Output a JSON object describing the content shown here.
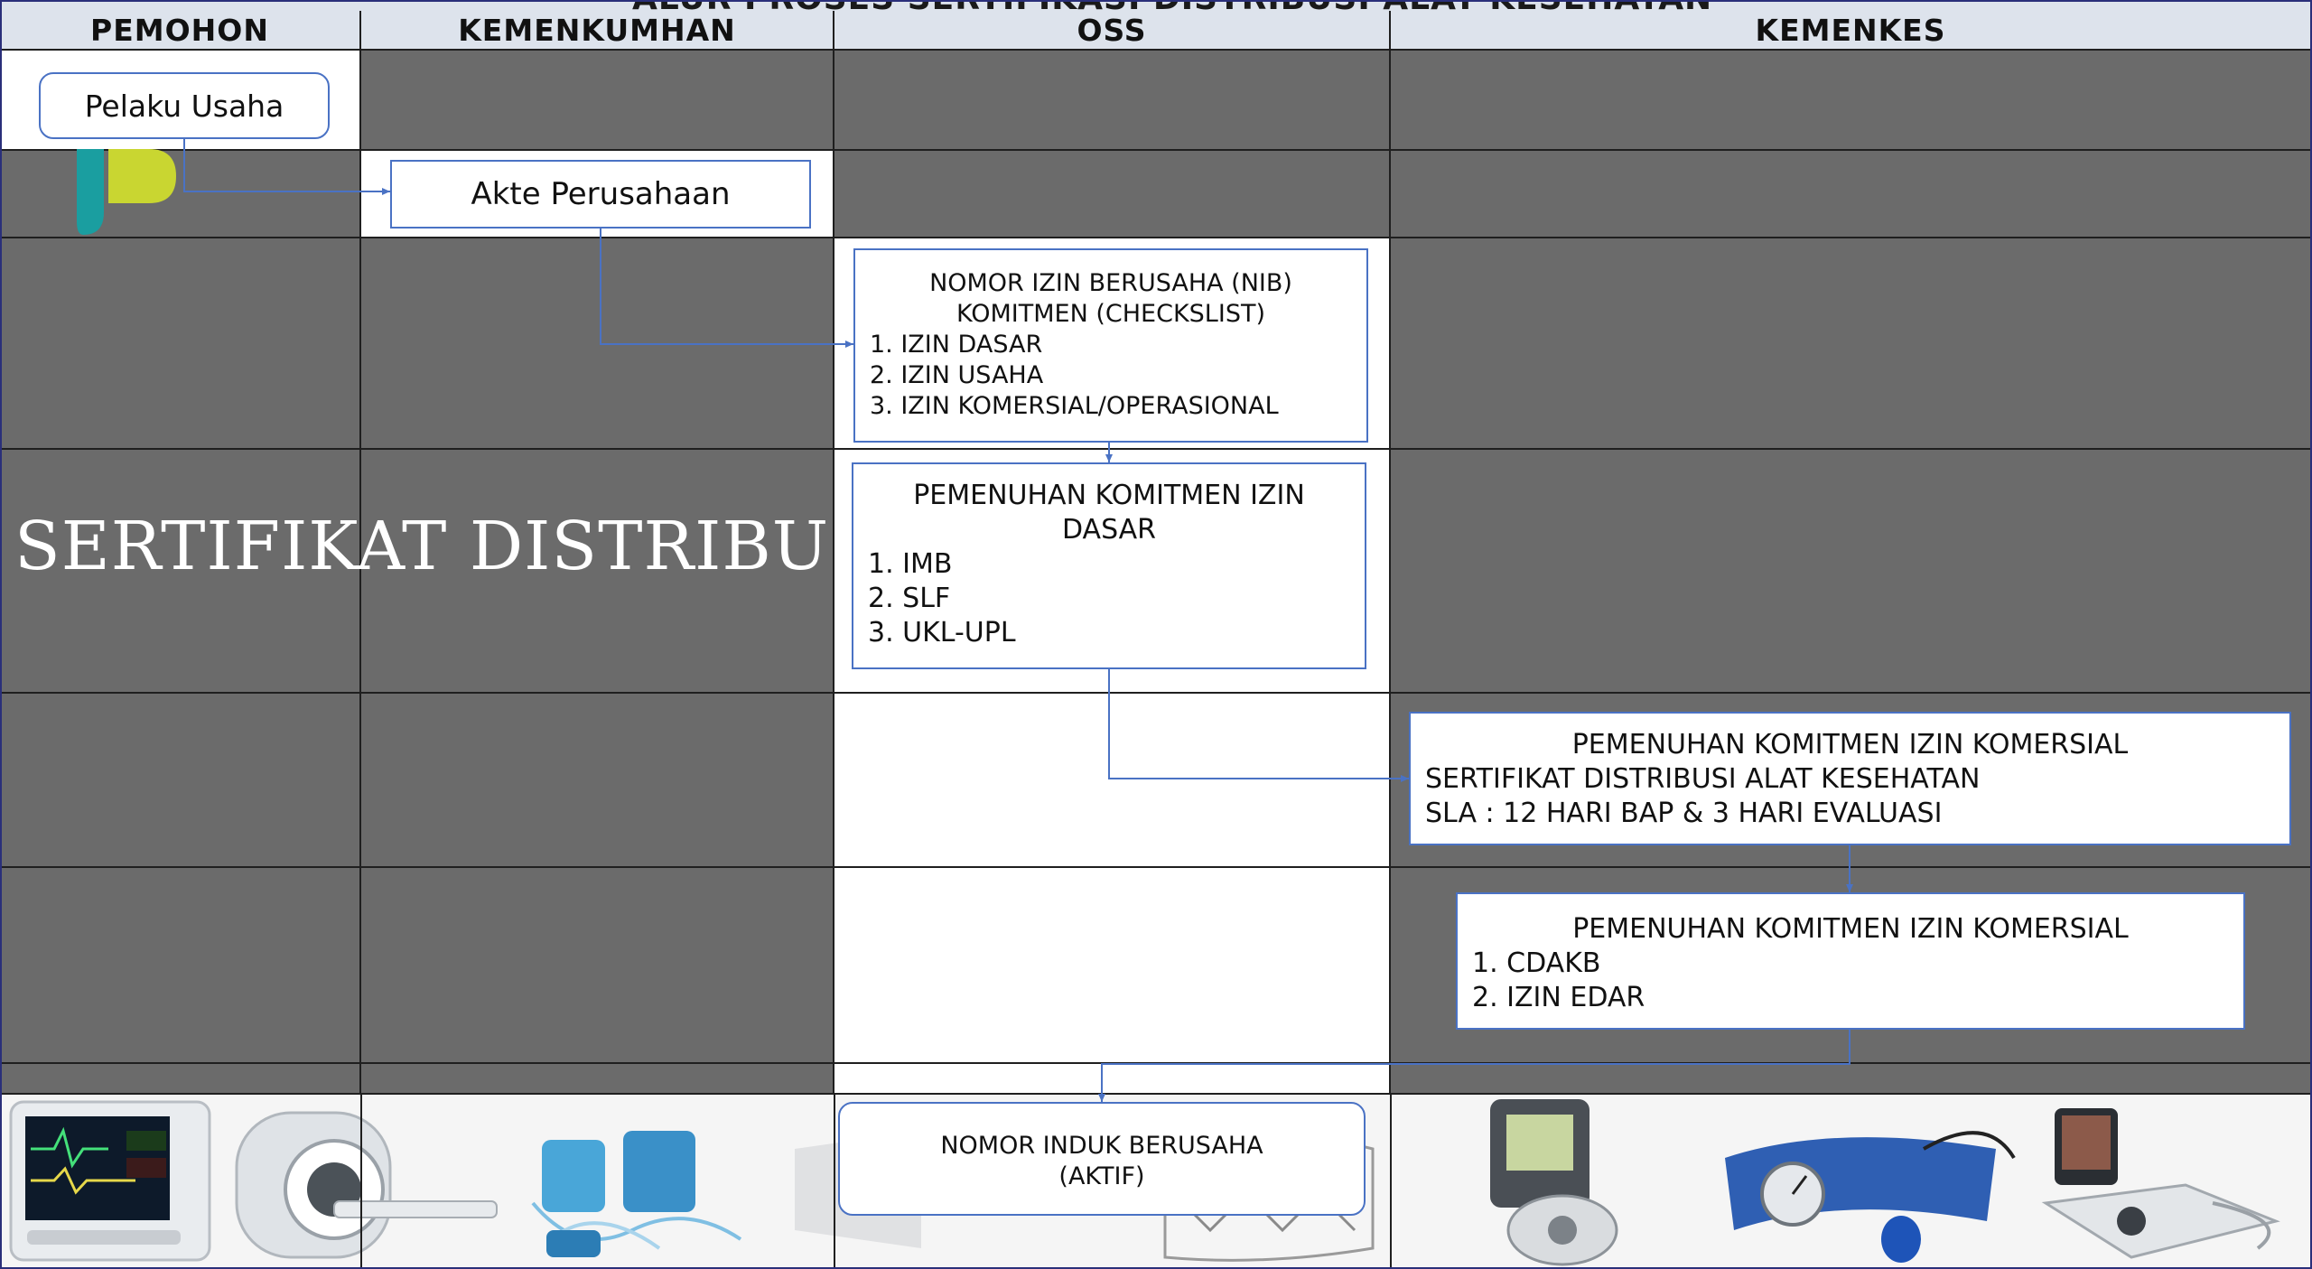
{
  "title": "ALUR PROSES SERTIFIKASI DISTRIBUSI ALAT KESEHATAN",
  "lanes": [
    {
      "label": "PEMOHON"
    },
    {
      "label": "KEMENKUMHAN"
    },
    {
      "label": "OSS"
    },
    {
      "label": "KEMENKES"
    }
  ],
  "side_label": "SERTIFIKAT DISTRIBUSI",
  "steps": {
    "pelaku": "Pelaku Usaha",
    "akte": "Akte Perusahaan",
    "nib": {
      "line1": "NOMOR IZIN BERUSAHA (NIB)",
      "line2": "KOMITMEN (CHECKSLIST)",
      "items": [
        "1. IZIN DASAR",
        "2. IZIN USAHA",
        "3. IZIN KOMERSIAL/OPERASIONAL"
      ]
    },
    "izin_dasar": {
      "title": "PEMENUHAN KOMITMEN IZIN DASAR",
      "items": [
        "1. IMB",
        "2. SLF",
        "3. UKL-UPL"
      ]
    },
    "komersial_1": {
      "title": "PEMENUHAN KOMITMEN IZIN KOMERSIAL",
      "lines": [
        "SERTIFIKAT DISTRIBUSI ALAT KESEHATAN",
        "SLA : 12 HARI BAP & 3 HARI EVALUASI"
      ]
    },
    "komersial_2": {
      "title": "PEMENUHAN KOMITMEN IZIN KOMERSIAL",
      "items": [
        "1. CDAKB",
        "2. IZIN EDAR"
      ]
    },
    "nomor_induk": {
      "line1": "NOMOR INDUK BERUSAHA",
      "line2": "(AKTIF)"
    }
  },
  "colors": {
    "dark_cell": "#6b6b6b",
    "header_bg": "#dde3ec",
    "connector": "#4a72c4",
    "logo_teal": "#1a9ea0",
    "logo_lime": "#c9d631"
  },
  "icons": [
    "patient-monitor-icon",
    "mri-scanner-icon",
    "iv-bag-set-icon",
    "stent-icon",
    "pacemaker-icon",
    "blood-pressure-cuff-icon",
    "ultrasound-device-icon"
  ]
}
